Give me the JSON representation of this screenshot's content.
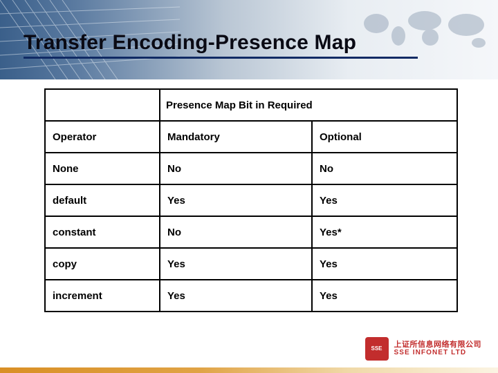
{
  "title": "Transfer Encoding-Presence Map",
  "chart_data": {
    "type": "table",
    "title": "Presence Map Bit in Required",
    "columns": [
      "Operator",
      "Mandatory",
      "Optional"
    ],
    "rows": [
      [
        "None",
        "No",
        "No"
      ],
      [
        "default",
        "Yes",
        "Yes"
      ],
      [
        "constant",
        "No",
        "Yes*"
      ],
      [
        "copy",
        "Yes",
        "Yes"
      ],
      [
        "increment",
        "Yes",
        "Yes"
      ]
    ]
  },
  "logo": {
    "mark": "SSE",
    "cn": "上证所信息网络有限公司",
    "en": "SSE INFONET LTD"
  }
}
